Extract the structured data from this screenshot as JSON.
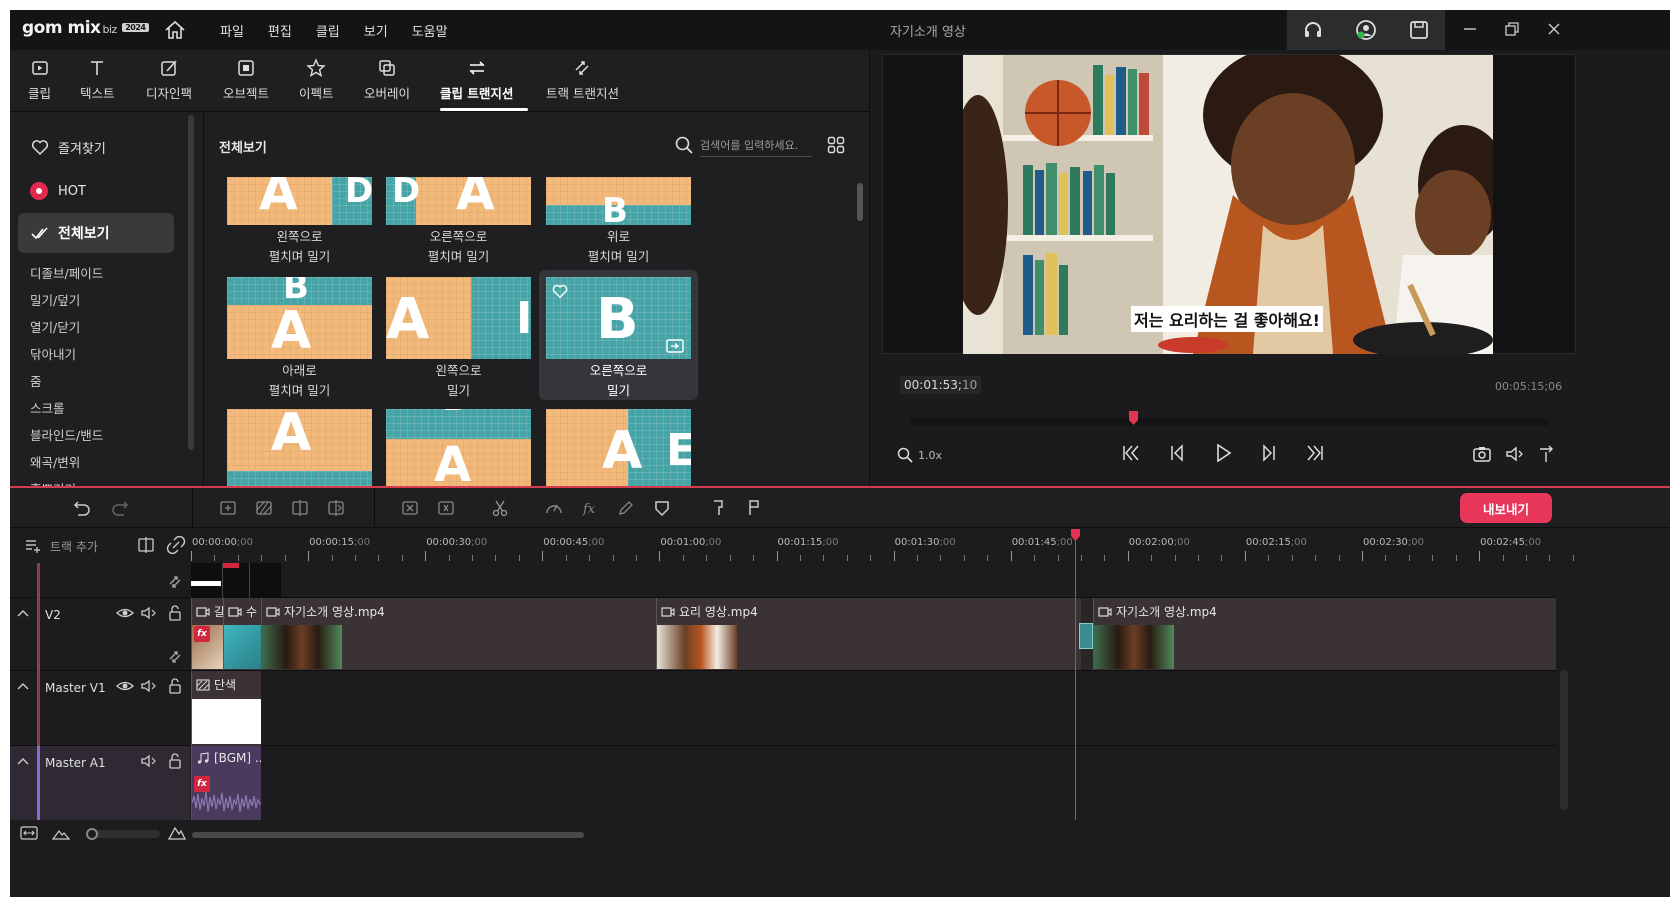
{
  "app": {
    "logo": "gom mix",
    "logo_sub": "biz",
    "logo_badge": "2024",
    "menu": [
      "파일",
      "편집",
      "클립",
      "보기",
      "도움말"
    ],
    "window_title": "자기소개 영상"
  },
  "tabs": [
    {
      "label": "클립",
      "icon": "clip-icon"
    },
    {
      "label": "텍스트",
      "icon": "text-icon"
    },
    {
      "label": "디자인팩",
      "icon": "design-pack-icon"
    },
    {
      "label": "오브젝트",
      "icon": "object-icon"
    },
    {
      "label": "이펙트",
      "icon": "effect-icon"
    },
    {
      "label": "오버레이",
      "icon": "overlay-icon"
    },
    {
      "label": "클립 트랜지션",
      "icon": "clip-transition-icon",
      "active": true
    },
    {
      "label": "트랙 트랜지션",
      "icon": "track-transition-icon"
    }
  ],
  "categories": {
    "favorites": "즐겨찾기",
    "hot": "HOT",
    "all": "전체보기",
    "items": [
      "디졸브/페이드",
      "밀기/덮기",
      "열기/닫기",
      "닦아내기",
      "줌",
      "스크롤",
      "블라인드/밴드",
      "왜곡/변위",
      "흩뿌리기"
    ]
  },
  "content": {
    "title": "전체보기",
    "search_placeholder": "검색어를 입력하세요.",
    "thumbnails": [
      {
        "line1": "왼쪽으로",
        "line2": "펼치며 밀기"
      },
      {
        "line1": "오른쪽으로",
        "line2": "펼치며 밀기"
      },
      {
        "line1": "위로",
        "line2": "펼치며 밀기"
      },
      {
        "line1": "아래로",
        "line2": "펼치며 밀기"
      },
      {
        "line1": "왼쪽으로",
        "line2": "밀기"
      },
      {
        "line1": "오른쪽으로",
        "line2": "밀기",
        "selected": true
      }
    ]
  },
  "preview": {
    "subtitle": "저는 요리하는 걸 좋아해요!",
    "current_time": "00:01:53;",
    "current_frame": "10",
    "duration": "00:05:15;06",
    "zoom": "1.0x",
    "progress": 0.35
  },
  "toolbar": {
    "export_label": "내보내기"
  },
  "timeline": {
    "add_track": "트랙 추가",
    "ruler": [
      {
        "t": "00:00:00",
        "f": ";00"
      },
      {
        "t": "00:00:15",
        "f": ";00"
      },
      {
        "t": "00:00:30",
        "f": ";00"
      },
      {
        "t": "00:00:45",
        "f": ";00"
      },
      {
        "t": "00:01:00",
        "f": ";00"
      },
      {
        "t": "00:01:15",
        "f": ";00"
      },
      {
        "t": "00:01:30",
        "f": ";00"
      },
      {
        "t": "00:01:45",
        "f": ";00"
      },
      {
        "t": "00:02:00",
        "f": ";00"
      },
      {
        "t": "00:02:15",
        "f": ";00"
      },
      {
        "t": "00:02:30",
        "f": ";00"
      },
      {
        "t": "00:02:45",
        "f": ";00"
      }
    ],
    "tracks": {
      "v2": "V2",
      "master_v1": "Master V1",
      "master_a1": "Master A1"
    },
    "clips": {
      "v2_a": "갈",
      "v2_b": "수",
      "v2_c": "자기소개 영상.mp4",
      "v2_d": "요리 영상.mp4",
      "v2_e": "자기소개 영상.mp4",
      "v1_a": "단색",
      "a1_a": "[BGM] ..."
    },
    "fx": "fx"
  },
  "colors": {
    "accent": "#e8375a",
    "track_video": "#b8464f",
    "track_audio": "#8a6bd6"
  }
}
